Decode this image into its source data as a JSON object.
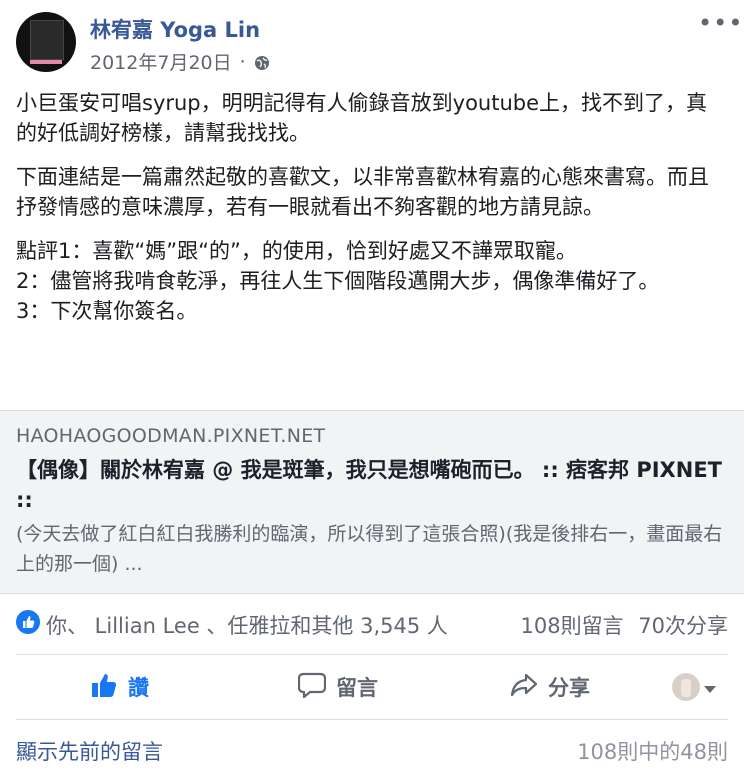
{
  "post": {
    "author": "林宥嘉 Yoga Lin",
    "date": "2012年7月20日",
    "separator": "·",
    "privacy_icon": "globe-icon",
    "more_icon": "more-options-icon",
    "paragraphs": [
      "小巨蛋安可唱syrup，明明記得有人偷錄音放到youtube上，找不到了，真的好低調好榜樣，請幫我找找。",
      "下面連結是一篇肅然起敬的喜歡文，以非常喜歡林宥嘉的心態來書寫。而且抒發情感的意味濃厚，若有一眼就看出不夠客觀的地方請見諒。",
      "點評1：喜歡“媽”跟“的”，的使用，恰到好處又不譁眾取寵。\n2：儘管將我啃食乾淨，再往人生下個階段邁開大步，偶像準備好了。\n3：下次幫你簽名。"
    ]
  },
  "link_preview": {
    "domain": "HAOHAOGOODMAN.PIXNET.NET",
    "title": "【偶像】關於林宥嘉 @ 我是斑筆，我只是想嘴砲而已。 :: 痞客邦 PIXNET ::",
    "description": "(今天去做了紅白紅白我勝利的臨演，所以得到了這張合照)(我是後排右一，畫面最右上的那一個) ..."
  },
  "reactions": {
    "names": "你、 Lillian Lee 、任雅拉和其他 3,545 人",
    "comments": "108則留言",
    "shares": "70次分享",
    "badge_color": "#1877f2"
  },
  "actions": {
    "like": "讚",
    "comment": "留言",
    "share": "分享"
  },
  "comments_footer": {
    "show_previous": "顯示先前的留言",
    "count": "108則中的48則"
  },
  "colors": {
    "link": "#385898",
    "muted": "#606770",
    "accent": "#1877f2"
  }
}
